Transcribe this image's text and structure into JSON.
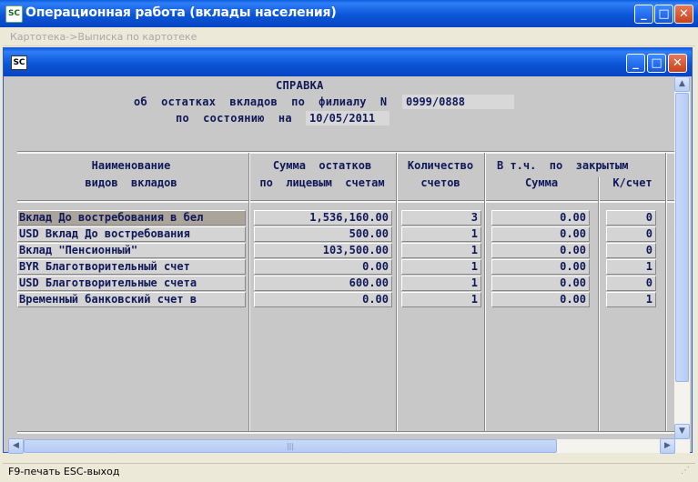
{
  "app": {
    "title": "Операционная работа (вклады населения)",
    "icon_text": "SC",
    "icon": "app-icon"
  },
  "breadcrumb": "Картотека->Выписка по картотеке",
  "inner_window": {
    "icon_text": "SC"
  },
  "report": {
    "heading": "СПРАВКА",
    "subtitle": "об  остатках  вкладов  по  филиалу  N",
    "branch": "0999/0888",
    "date_label": "по  состоянию  на",
    "date": "10/05/2011",
    "columns": {
      "name": [
        "Наименование",
        "видов  вкладов"
      ],
      "sum": [
        "Сумма  остатков",
        "по  лицевым  счетам"
      ],
      "count": [
        "Количество",
        "счетов"
      ],
      "closed": "В т.ч.  по  закрытым",
      "closed_sum": "Сумма",
      "closed_count": "К/счет"
    },
    "rows": [
      {
        "name": "Вклад До востребования в бел",
        "sum": "1,536,160.00",
        "count": "3",
        "closed_sum": "0.00",
        "closed_count": "0"
      },
      {
        "name": "USD Вклад До востребования",
        "sum": "500.00",
        "count": "1",
        "closed_sum": "0.00",
        "closed_count": "0"
      },
      {
        "name": "Вклад \"Пенсионный\"",
        "sum": "103,500.00",
        "count": "1",
        "closed_sum": "0.00",
        "closed_count": "0"
      },
      {
        "name": "BYR Благотворительный счет",
        "sum": "0.00",
        "count": "1",
        "closed_sum": "0.00",
        "closed_count": "1"
      },
      {
        "name": "USD Благотворительные счета",
        "sum": "600.00",
        "count": "1",
        "closed_sum": "0.00",
        "closed_count": "0"
      },
      {
        "name": "Временный банковский счет в",
        "sum": "0.00",
        "count": "1",
        "closed_sum": "0.00",
        "closed_count": "1"
      }
    ],
    "selected_row": 0
  },
  "status_bar": {
    "f9": "F9",
    "f9_text": "-печать ",
    "esc": "ESC",
    "esc_text": "-выход"
  }
}
